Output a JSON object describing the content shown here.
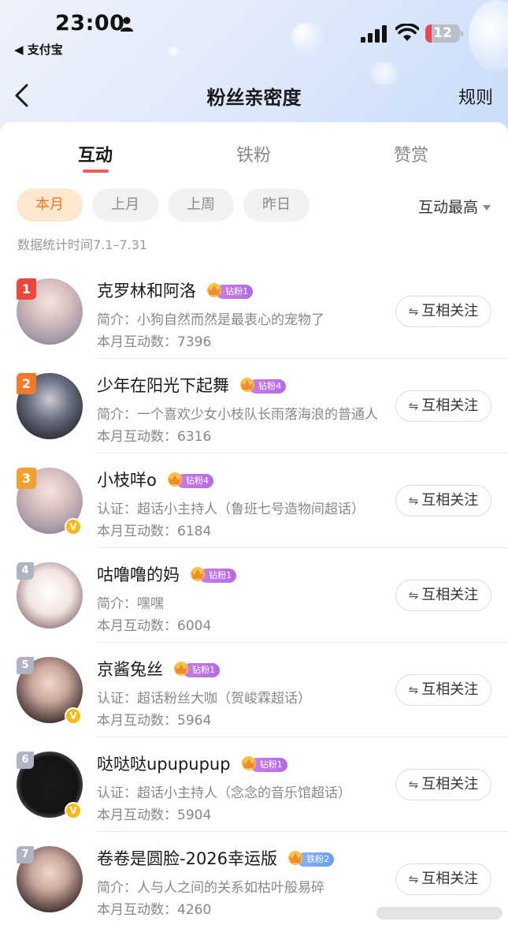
{
  "status_bar": {
    "time": "23:00",
    "back_app": "◀ 支付宝",
    "battery": "12",
    "battery_level": 0.12
  },
  "nav": {
    "title": "粉丝亲密度",
    "rules": "规则"
  },
  "tabs": [
    {
      "label": "互动",
      "active": true
    },
    {
      "label": "铁粉",
      "active": false
    },
    {
      "label": "赞赏",
      "active": false
    }
  ],
  "filters": {
    "chips": [
      "本月",
      "上月",
      "上周",
      "昨日"
    ],
    "active_chip": "本月",
    "sort": "互动最高"
  },
  "stat_range": "数据统计时间7.1–7.31",
  "follow_label": "互相关注",
  "colors": {
    "accent_red": "#f25a55",
    "chip_active_bg": "#fde7cf",
    "chip_active_text": "#ee7a28",
    "diamond_badge": "#b46ae6",
    "iron_badge": "#6b9ff0",
    "verified": "#fbb80f"
  },
  "fans": [
    {
      "rank": "1",
      "name": "克罗林和阿洛",
      "badge": "钻粉1",
      "badge_type": "diamond",
      "desc": "简介：小狗自然而然是最衷心的宠物了",
      "count": "本月互动数：7396",
      "verified": false,
      "avatar_icon": "anime-girl-avatar"
    },
    {
      "rank": "2",
      "name": "少年在阳光下起舞",
      "badge": "钻粉4",
      "badge_type": "diamond",
      "desc": "简介：一个喜欢少女小枝队长雨落海浪的普通人",
      "count": "本月互动数：6316",
      "verified": false,
      "avatar_icon": "anime-boy-avatar"
    },
    {
      "rank": "3",
      "name": "小枝咩o",
      "badge": "钻粉4",
      "badge_type": "diamond",
      "desc": "认证：超话小主持人（鲁班七号造物间超话）",
      "count": "本月互动数：6184",
      "verified": true,
      "avatar_icon": "anime-girl-avatar"
    },
    {
      "rank": "4",
      "name": "咕噜噜的妈",
      "badge": "钻粉1",
      "badge_type": "diamond",
      "desc": "简介：嘿嘿",
      "count": "本月互动数：6004",
      "verified": false,
      "avatar_icon": "rabbit-avatar"
    },
    {
      "rank": "5",
      "name": "京酱兔丝",
      "badge": "钻粉1",
      "badge_type": "diamond",
      "desc": "认证：超话粉丝大咖（贺峻霖超话）",
      "count": "本月互动数：5964",
      "verified": true,
      "avatar_icon": "girl-photo-avatar"
    },
    {
      "rank": "6",
      "name": "哒哒哒upupupup",
      "badge": "钻粉1",
      "badge_type": "diamond",
      "desc": "认证：超话小主持人（念念的音乐馆超话）",
      "count": "本月互动数：5904",
      "verified": true,
      "avatar_icon": "black-cat-avatar"
    },
    {
      "rank": "7",
      "name": "卷卷是圆脸-2026幸运版",
      "badge": "铁粉2",
      "badge_type": "iron",
      "desc": "简介：人与人之间的关系如枯叶般易碎",
      "count": "本月互动数：4260",
      "verified": false,
      "avatar_icon": "girl-photo-avatar"
    }
  ]
}
